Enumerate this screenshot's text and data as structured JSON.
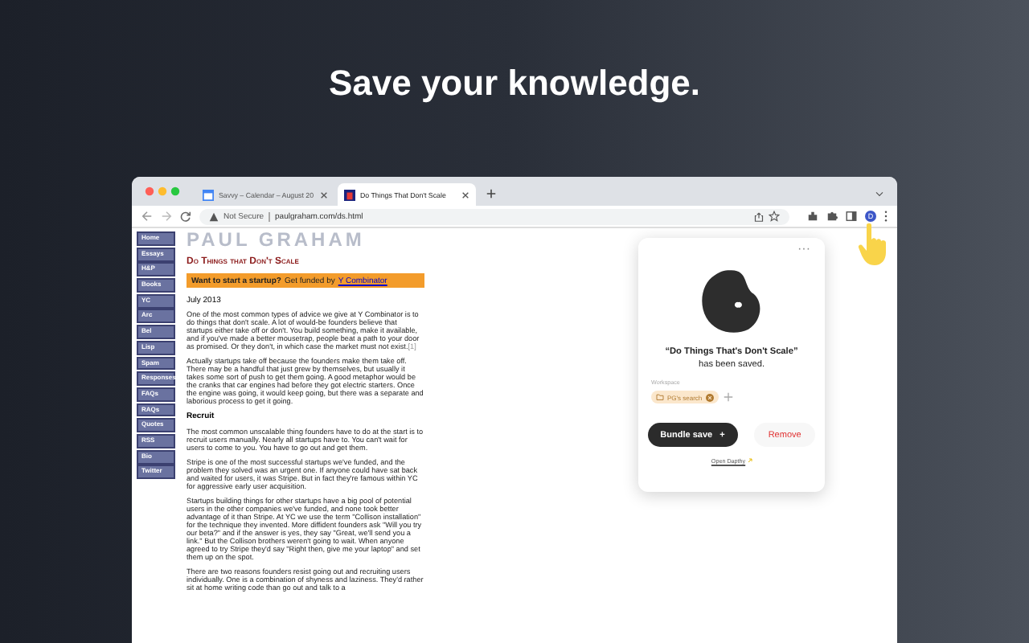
{
  "headline": "Save your knowledge.",
  "browser": {
    "tabs": [
      {
        "title": "Savvy – Calendar – August 20",
        "selected": false
      },
      {
        "title": "Do Things That Don't Scale",
        "selected": true
      }
    ],
    "security": "Not Secure",
    "url": "paulgraham.com/ds.html",
    "profile_initial": "D"
  },
  "page": {
    "nav": [
      "Home",
      "Essays",
      "H&P",
      "Books",
      "YC",
      "Arc",
      "Bel",
      "Lisp",
      "Spam",
      "Responses",
      "FAQs",
      "RAQs",
      "Quotes",
      "RSS",
      "Bio",
      "Twitter"
    ],
    "site_title": "PAUL GRAHAM",
    "essay_title": "Do Things that Don't Scale",
    "banner": {
      "lead": "Want to start a startup?",
      "text": "Get funded by",
      "link": "Y Combinator"
    },
    "date": "July 2013",
    "blocks": [
      {
        "kind": "paragraph",
        "text": "One of the most common types of advice we give at Y Combinator is to do things that don't scale. A lot of would-be founders believe that startups either take off or don't. You build something, make it available, and if you've made a better mousetrap, people beat a path to your door as promised. Or they don't, in which case the market must not exist.",
        "footnote": "[1]"
      },
      {
        "kind": "paragraph",
        "text": "Actually startups take off because the founders make them take off. There may be a handful that just grew by themselves, but usually it takes some sort of push to get them going. A good metaphor would be the cranks that car engines had before they got electric starters. Once the engine was going, it would keep going, but there was a separate and laborious process to get it going."
      },
      {
        "kind": "heading",
        "text": "Recruit"
      },
      {
        "kind": "paragraph",
        "text": "The most common unscalable thing founders have to do at the start is to recruit users manually. Nearly all startups have to. You can't wait for users to come to you. You have to go out and get them."
      },
      {
        "kind": "paragraph",
        "text": "Stripe is one of the most successful startups we've funded, and the problem they solved was an urgent one. If anyone could have sat back and waited for users, it was Stripe. But in fact they're famous within YC for aggressive early user acquisition."
      },
      {
        "kind": "paragraph",
        "text": "Startups building things for other startups have a big pool of potential users in the other companies we've funded, and none took better advantage of it than Stripe. At YC we use the term \"Collison installation\" for the technique they invented. More diffident founders ask \"Will you try our beta?\" and if the answer is yes, they say \"Great, we'll send you a link.\" But the Collison brothers weren't going to wait. When anyone agreed to try Stripe they'd say \"Right then, give me your laptop\" and set them up on the spot."
      },
      {
        "kind": "paragraph",
        "text": "There are two reasons founders resist going out and recruiting users individually. One is a combination of shyness and laziness. They'd rather sit at home writing code than go out and talk to a"
      }
    ]
  },
  "popup": {
    "menu": "···",
    "title": "“Do Things That's Don't Scale”",
    "status": "has been saved.",
    "workspace_label": "Workspace",
    "chip": "PG's search",
    "primary": "Bundle save",
    "primary_icon": "+",
    "secondary": "Remove",
    "link": "Open Dapthy"
  }
}
